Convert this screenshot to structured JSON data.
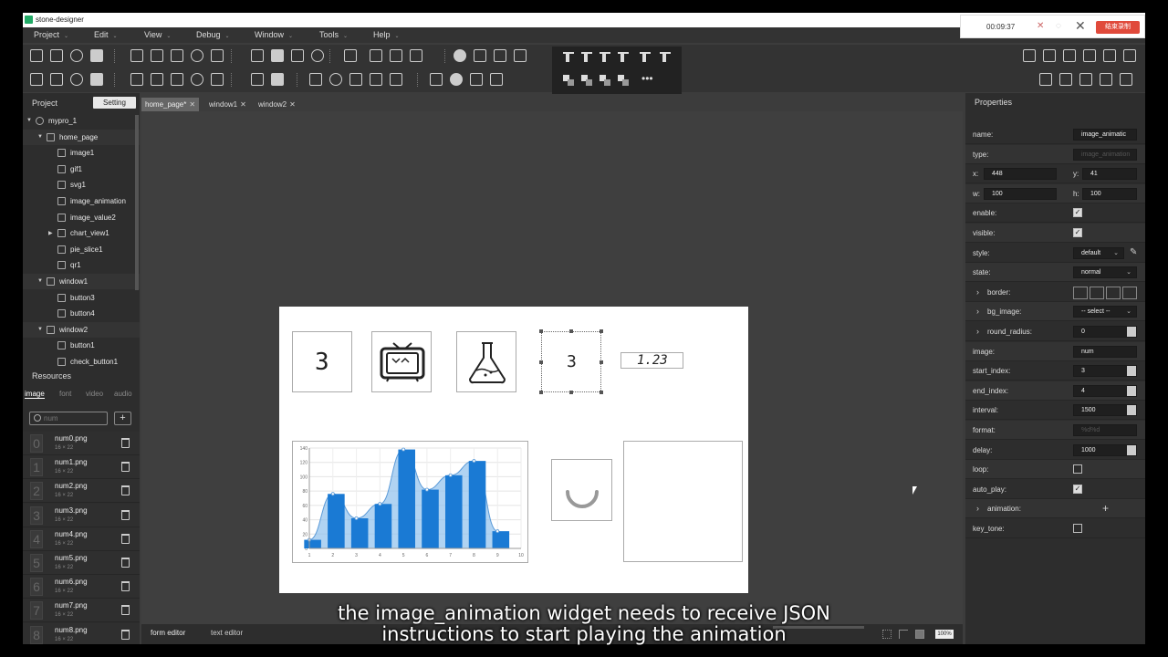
{
  "app": {
    "title": "stone-designer"
  },
  "recorder": {
    "time": "00:09:37",
    "stop_label": "结束录制"
  },
  "menu": [
    "Project",
    "Edit",
    "View",
    "Debug",
    "Window",
    "Tools",
    "Help"
  ],
  "left_panel": {
    "title": "Project",
    "setting_label": "Setting",
    "tree": [
      {
        "label": "mypro_1",
        "level": 0,
        "expanded": true
      },
      {
        "label": "home_page",
        "level": 1,
        "expanded": true
      },
      {
        "label": "image1",
        "level": 2
      },
      {
        "label": "gif1",
        "level": 2
      },
      {
        "label": "svg1",
        "level": 2
      },
      {
        "label": "image_animation",
        "level": 2
      },
      {
        "label": "image_value2",
        "level": 2
      },
      {
        "label": "chart_view1",
        "level": 2,
        "collapsed": true
      },
      {
        "label": "pie_slice1",
        "level": 2
      },
      {
        "label": "qr1",
        "level": 2
      },
      {
        "label": "window1",
        "level": 1,
        "expanded": true
      },
      {
        "label": "button3",
        "level": 2
      },
      {
        "label": "button4",
        "level": 2
      },
      {
        "label": "window2",
        "level": 1,
        "expanded": true
      },
      {
        "label": "button1",
        "level": 2
      },
      {
        "label": "check_button1",
        "level": 2
      }
    ]
  },
  "resources": {
    "title": "Resources",
    "tabs": [
      "image",
      "font",
      "video",
      "audio"
    ],
    "active_tab": "image",
    "search_placeholder": "num",
    "add_label": "+",
    "items": [
      {
        "name": "num0.png",
        "size": "16 × 22",
        "glyph": "0"
      },
      {
        "name": "num1.png",
        "size": "16 × 22",
        "glyph": "1"
      },
      {
        "name": "num2.png",
        "size": "16 × 22",
        "glyph": "2"
      },
      {
        "name": "num3.png",
        "size": "16 × 22",
        "glyph": "3"
      },
      {
        "name": "num4.png",
        "size": "16 × 22",
        "glyph": "4"
      },
      {
        "name": "num5.png",
        "size": "16 × 22",
        "glyph": "5"
      },
      {
        "name": "num6.png",
        "size": "16 × 22",
        "glyph": "6"
      },
      {
        "name": "num7.png",
        "size": "16 × 22",
        "glyph": "7"
      },
      {
        "name": "num8.png",
        "size": "16 × 22",
        "glyph": "8"
      }
    ]
  },
  "doc_tabs": [
    {
      "label": "home_page*",
      "active": true
    },
    {
      "label": "window1",
      "active": false
    },
    {
      "label": "window2",
      "active": false
    }
  ],
  "canvas": {
    "image1_digit": "3",
    "anim_digit": "3",
    "image_value": "1.23",
    "chart_data": {
      "type": "bar",
      "categories": [
        "1",
        "2",
        "3",
        "4",
        "5",
        "6",
        "7",
        "8",
        "9",
        "10"
      ],
      "values": [
        12,
        76,
        42,
        62,
        138,
        82,
        102,
        122,
        24
      ],
      "line_values": [
        12,
        76,
        42,
        62,
        138,
        82,
        102,
        122,
        24
      ],
      "ylim": [
        0,
        140
      ],
      "y_ticks": [
        "0",
        "20",
        "40",
        "60",
        "80",
        "100",
        "120",
        "140"
      ],
      "x_ticks": [
        "1",
        "2",
        "3",
        "4",
        "5",
        "6",
        "7",
        "8",
        "9",
        "10"
      ],
      "bar_color": "#1a7ad4",
      "area_color": "#8ec0ec"
    }
  },
  "bottom_tabs": {
    "form_editor": "form editor",
    "text_editor": "text editor",
    "zoom": "100%"
  },
  "properties": {
    "title": "Properties",
    "name": "image_animatic",
    "type": "image_animation",
    "x": "448",
    "y": "41",
    "w": "100",
    "h": "100",
    "enable": true,
    "visible": true,
    "style": "default",
    "state": "normal",
    "bg_image": "-- select --",
    "round_radius": "0",
    "image": "num",
    "start_index": "3",
    "end_index": "4",
    "interval": "1500",
    "format": "%d%d",
    "delay": "1000",
    "loop": false,
    "auto_play": true,
    "key_tone": false,
    "labels": {
      "name": "name:",
      "type": "type:",
      "x": "x:",
      "y": "y:",
      "w": "w:",
      "h": "h:",
      "enable": "enable:",
      "visible": "visible:",
      "style": "style:",
      "state": "state:",
      "border": "border:",
      "bg_image": "bg_image:",
      "round_radius": "round_radius:",
      "image": "image:",
      "start_index": "start_index:",
      "end_index": "end_index:",
      "interval": "interval:",
      "format": "format:",
      "delay": "delay:",
      "loop": "loop:",
      "auto_play": "auto_play:",
      "animation": "animation:",
      "key_tone": "key_tone:"
    }
  },
  "subtitle": {
    "line1": "the image_animation widget needs to receive JSON",
    "line2": "instructions to start playing the animation"
  }
}
